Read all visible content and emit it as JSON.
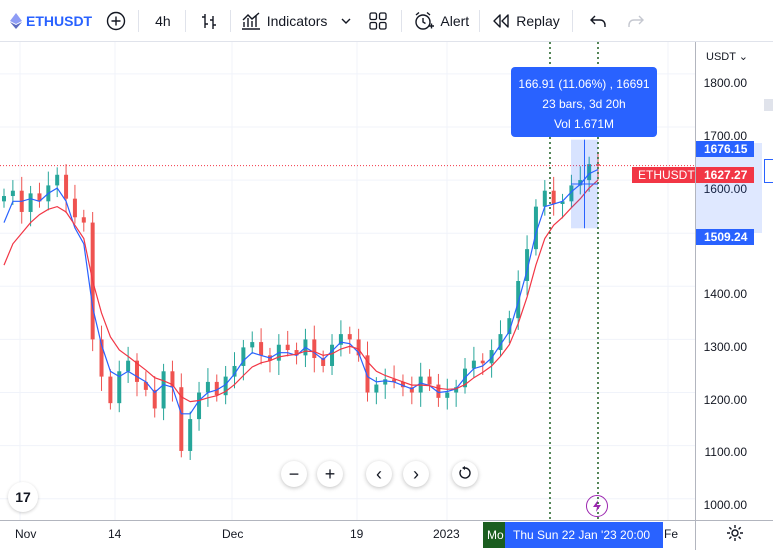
{
  "toolbar": {
    "symbol": "ETHUSDT",
    "interval": "4h",
    "indicators_label": "Indicators",
    "alert_label": "Alert",
    "replay_label": "Replay"
  },
  "price_scale": {
    "currency": "USDT ⌄",
    "labels": [
      "1800.00",
      "1700.00",
      "1600.00",
      "1400.00",
      "1300.00",
      "1200.00",
      "1100.00",
      "1000.00"
    ],
    "tag_high": "1676.15",
    "tag_current": "1627.27",
    "tag_low": "1509.24"
  },
  "time_scale": {
    "labels": [
      "Nov",
      "14",
      "Dec",
      "19",
      "2023",
      "Fe"
    ],
    "range_marker": "Mo",
    "cursor_label": "Thu   Sun 22 Jan '23   20:00"
  },
  "measure_tooltip": {
    "line1": "166.91 (11.06%) , 16691",
    "line2": "23 bars, 3d 20h",
    "line3": "Vol 1.671M"
  },
  "symbol_label": "ETHUSDT",
  "logo_text": "17",
  "colors": {
    "accent": "#2962ff",
    "up": "#26a69a",
    "down": "#ef5350",
    "ma_fast": "#2962ff",
    "ma_slow": "#f23645",
    "price_line": "#f23645"
  },
  "chart_data": {
    "type": "line",
    "title": "",
    "xlabel": "",
    "ylabel": "",
    "ylim": [
      960,
      1860
    ],
    "x_ticks": [
      "Nov",
      "14",
      "Dec",
      "19",
      "2023",
      "Fe"
    ],
    "series": [
      {
        "values": [
          1570,
          1580,
          1540,
          1575,
          1560,
          1590,
          1610,
          1565,
          1530,
          1520,
          1300,
          1230,
          1180,
          1240,
          1260,
          1220,
          1205,
          1170,
          1240,
          1210,
          1090,
          1150,
          1200,
          1220,
          1195,
          1230,
          1250,
          1285,
          1295,
          1270,
          1260,
          1290,
          1280,
          1270,
          1300,
          1265,
          1250,
          1290,
          1310,
          1300,
          1270,
          1200,
          1215,
          1225,
          1220,
          1210,
          1200,
          1230,
          1215,
          1190,
          1200,
          1210,
          1245,
          1260,
          1255,
          1280,
          1310,
          1340,
          1410,
          1470,
          1550,
          1580,
          1555,
          1560,
          1590,
          1600,
          1630,
          1627
        ]
      },
      {
        "values": [
          1520,
          1560,
          1560,
          1565,
          1560,
          1575,
          1585,
          1560,
          1510,
          1480,
          1360,
          1290,
          1240,
          1230,
          1240,
          1230,
          1220,
          1200,
          1215,
          1210,
          1160,
          1160,
          1185,
          1200,
          1205,
          1215,
          1235,
          1260,
          1275,
          1270,
          1265,
          1275,
          1275,
          1270,
          1285,
          1275,
          1262,
          1278,
          1295,
          1292,
          1275,
          1230,
          1220,
          1222,
          1220,
          1213,
          1207,
          1218,
          1213,
          1200,
          1202,
          1207,
          1228,
          1245,
          1250,
          1265,
          1290,
          1315,
          1370,
          1430,
          1500,
          1550,
          1555,
          1560,
          1578,
          1592,
          1612,
          1620
        ]
      },
      {
        "values": [
          1440,
          1480,
          1500,
          1520,
          1535,
          1545,
          1550,
          1540,
          1515,
          1490,
          1410,
          1350,
          1305,
          1280,
          1268,
          1255,
          1242,
          1228,
          1222,
          1215,
          1192,
          1183,
          1185,
          1190,
          1194,
          1202,
          1215,
          1232,
          1248,
          1256,
          1260,
          1267,
          1270,
          1272,
          1278,
          1277,
          1270,
          1273,
          1282,
          1287,
          1282,
          1258,
          1240,
          1232,
          1226,
          1220,
          1214,
          1214,
          1213,
          1208,
          1206,
          1207,
          1215,
          1228,
          1238,
          1250,
          1268,
          1290,
          1330,
          1380,
          1440,
          1490,
          1515,
          1530,
          1548,
          1565,
          1585,
          1600
        ]
      }
    ],
    "current_price": 1627.27,
    "measure_range": {
      "high": 1676.15,
      "low": 1509.24
    }
  }
}
